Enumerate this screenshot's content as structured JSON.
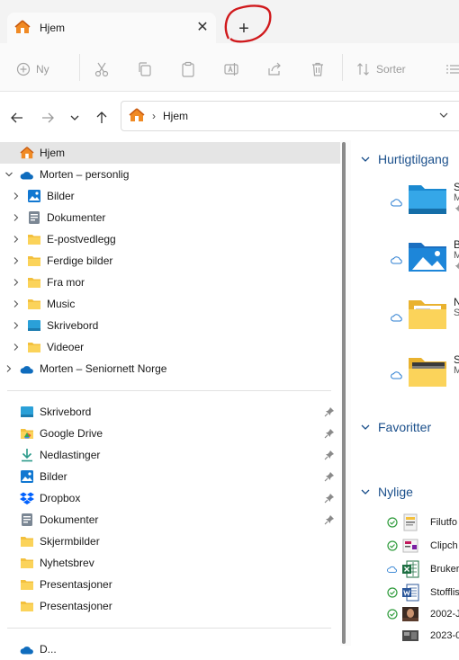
{
  "tab": {
    "title": "Hjem",
    "close_glyph": "✕",
    "new_tab_glyph": "+"
  },
  "toolbar": {
    "new_label": "Ny",
    "sort_label": "Sorter"
  },
  "address": {
    "crumb": "Hjem"
  },
  "sidebar": {
    "home": "Hjem",
    "onedrive_personal": "Morten – personlig",
    "onedrive_children": [
      "Bilder",
      "Dokumenter",
      "E-postvedlegg",
      "Ferdige bilder",
      "Fra mor",
      "Music",
      "Skrivebord",
      "Videoer"
    ],
    "onedrive_org": "Morten – Seniornett Norge",
    "pinned": [
      "Skrivebord",
      "Google Drive",
      "Nedlastinger",
      "Bilder",
      "Dropbox",
      "Dokumenter"
    ],
    "unpinned": [
      "Skjermbilder",
      "Nyhetsbrev",
      "Presentasjoner",
      "Presentasjoner"
    ],
    "last_partial": "D..."
  },
  "main": {
    "quick_access": {
      "title": "Hurtigtilgang",
      "items": [
        {
          "line1": "S",
          "line2": "M"
        },
        {
          "line1": "B",
          "line2": "M"
        },
        {
          "line1": "N",
          "line2": "S"
        },
        {
          "line1": "S",
          "line2": "M"
        }
      ]
    },
    "favorites": {
      "title": "Favoritter"
    },
    "recent": {
      "title": "Nylige",
      "items": [
        "Filutfo",
        "Clipch",
        "Bruker",
        "Stofflis",
        "2002-J",
        "2023-0"
      ]
    }
  },
  "colors": {
    "accent": "#0067c0",
    "selected_bg": "#e5e5e5",
    "annotation": "#d0191c",
    "folder_yellow": "#f3c03d"
  }
}
